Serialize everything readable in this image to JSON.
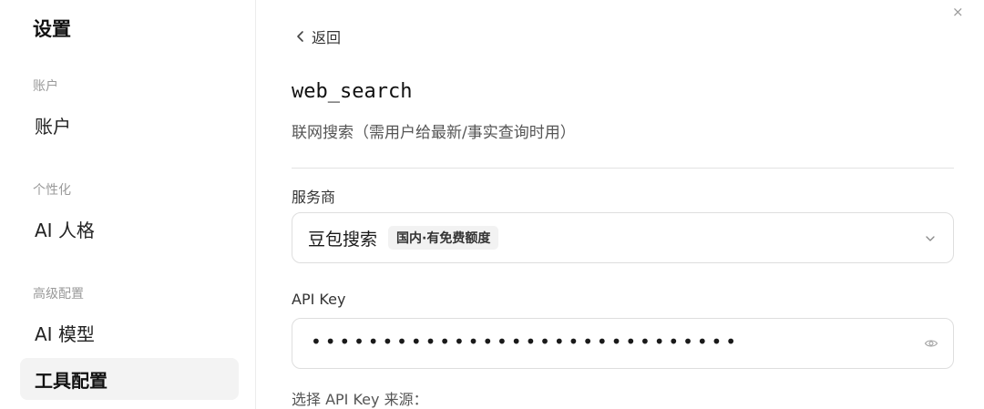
{
  "sidebar": {
    "title": "设置",
    "sections": [
      {
        "label": "账户",
        "items": [
          {
            "label": "账户",
            "active": false
          }
        ]
      },
      {
        "label": "个性化",
        "items": [
          {
            "label": "AI 人格",
            "active": false
          }
        ]
      },
      {
        "label": "高级配置",
        "items": [
          {
            "label": "AI 模型",
            "active": false
          },
          {
            "label": "工具配置",
            "active": true
          }
        ]
      }
    ]
  },
  "window": {
    "close_glyph": "×"
  },
  "main": {
    "back_label": "返回",
    "tool_name": "web_search",
    "tool_description": "联网搜索（需用户给最新/事实查询时用）",
    "provider": {
      "label": "服务商",
      "value": "豆包搜索",
      "badge": "国内·有免费额度"
    },
    "api_key": {
      "label": "API Key",
      "masked_value": "••••••••••••••••••••••••••••••"
    },
    "source_hint": "选择 API Key 来源："
  },
  "icons": {
    "back": "chevron-left-icon",
    "dropdown": "chevron-down-icon",
    "visibility": "eye-icon",
    "close": "close-icon"
  }
}
